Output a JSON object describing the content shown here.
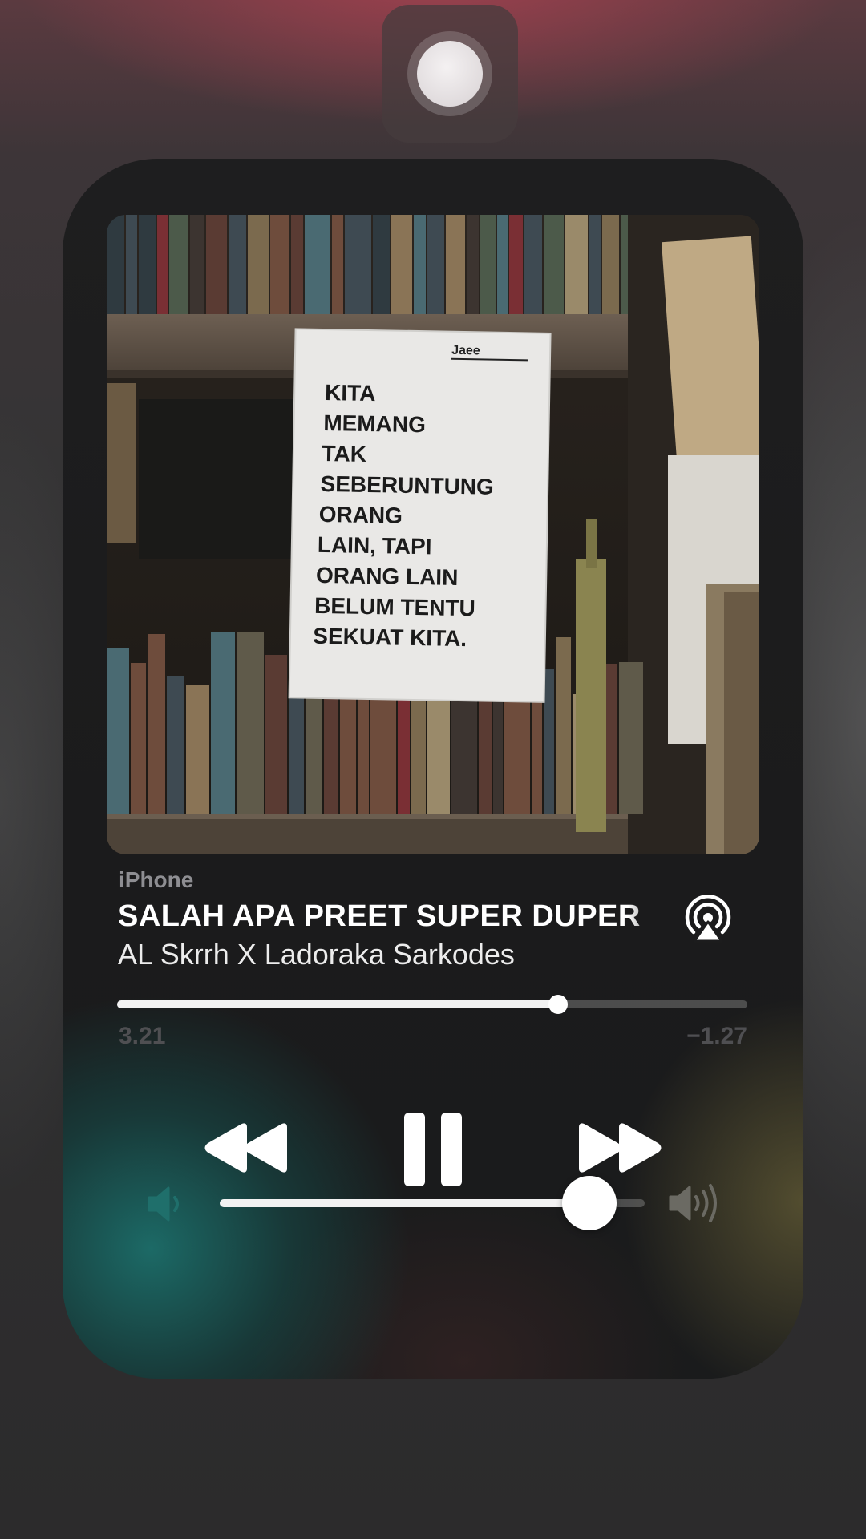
{
  "now_playing": {
    "source": "iPhone",
    "title": "SALAH APA PREET SUPER DUPER",
    "artist": "AL Skrrh X Ladoraka Sarkodes",
    "elapsed": "3.21",
    "remaining": "−1.27",
    "progress_fraction": 0.7,
    "volume_fraction": 0.87
  },
  "artwork": {
    "poster_author": "Jaee",
    "poster_lines": [
      "KITA",
      "MEMANG",
      "TAK",
      "SEBERUNTUNG",
      "ORANG",
      "LAIN, TAPI",
      "ORANG LAIN",
      "BELUM TENTU",
      "SEKUAT KITA."
    ]
  },
  "icons": {
    "top_toggle": "circle-toggle-icon",
    "airplay": "airplay-icon",
    "rewind": "rewind-icon",
    "pause": "pause-icon",
    "fast_forward": "fast-forward-icon",
    "volume_low": "speaker-low-icon",
    "volume_high": "speaker-high-icon"
  },
  "colors": {
    "accent_teal": "#1c6e6a",
    "time_label": "#4f4f52",
    "source_label": "#8e8e92",
    "knob": "#ffffff"
  }
}
